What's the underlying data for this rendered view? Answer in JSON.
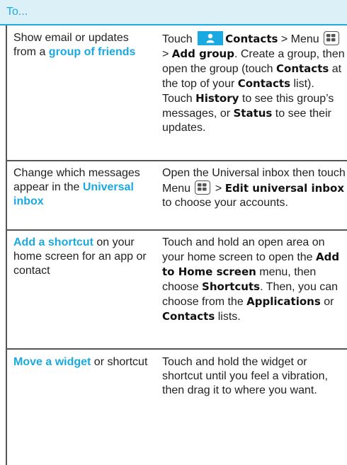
{
  "header": {
    "title": "To..."
  },
  "rows": [
    {
      "left": {
        "pre": "Show email or updates from a ",
        "link": "group of friends",
        "post": ""
      },
      "right": {
        "t1": "Touch ",
        "b1": "Contacts",
        "t2": " > Menu ",
        "t3": " > ",
        "b2": "Add group",
        "t4": ". Create a group, then open the group (touch ",
        "b3": "Contacts",
        "t5": " at the top of your ",
        "b4": "Contacts",
        "t6": " list). Touch ",
        "b5": "History",
        "t7": " to see this group’s messages, or ",
        "b6": "Status",
        "t8": " to see their updates."
      }
    },
    {
      "left": {
        "pre": "Change which messages appear in the ",
        "link": "Universal inbox",
        "post": ""
      },
      "right": {
        "t1": "Open the Universal inbox then touch Menu ",
        "t2": " > ",
        "b1": "Edit universal inbox",
        "t3": " to choose your accounts."
      }
    },
    {
      "left": {
        "pre": "",
        "link": "Add a shortcut",
        "post": " on your home screen for an app or contact"
      },
      "right": {
        "t1": "Touch and hold an open area on your home screen to open the ",
        "b1": "Add to Home screen",
        "t2": " menu, then choose ",
        "b2": "Shortcuts",
        "t3": ". Then, you can choose from the ",
        "b3": "Applications",
        "t4": " or ",
        "b4": "Contacts",
        "t5": " lists."
      }
    },
    {
      "left": {
        "pre": "",
        "link": "Move a widget",
        "post": " or shortcut"
      },
      "right": {
        "t1": "Touch and hold the widget or shortcut until you feel a vibration, then drag it to where you want."
      }
    }
  ],
  "colors": {
    "accent": "#1aa9e0",
    "header_bg": "#dcf0f8",
    "rule": "#555555"
  },
  "icons": [
    "contacts-icon",
    "menu-icon"
  ]
}
